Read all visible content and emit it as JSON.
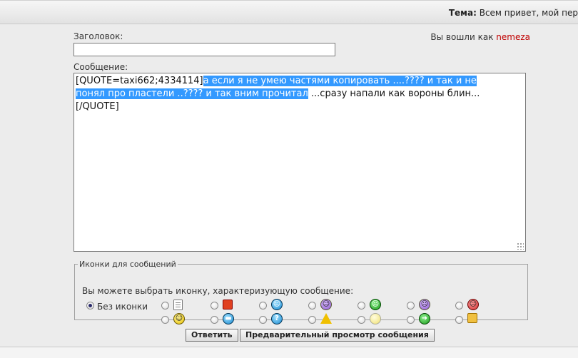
{
  "header": {
    "topic_label": "Тема:",
    "topic_text": "Всем привет, мой пер"
  },
  "form": {
    "title_label": "Заголовок:",
    "title_value": "",
    "logged_in_prefix": "Вы вошли как",
    "username": "nemeza",
    "message_label": "Сообщение:",
    "message": {
      "quote_open": "[QUOTE=taxi662;4334114]",
      "selected_line1": "а  если  я  не умею  частями  копировать ....????  и так  и не",
      "selected_line2": "понял про  пластели ..????   и  так  вним прочитал",
      "rest_line2": " ...сразу  напали  как  вороны  блин...",
      "quote_close": "[/QUOTE]"
    }
  },
  "icons_panel": {
    "legend": "Иконки для сообщений",
    "hint": "Вы можете выбрать иконку, характеризующую сообщение:",
    "no_icon_label": "Без иконки",
    "icon_names": [
      "document-icon",
      "thumbs-down-icon",
      "smile-icon",
      "tongue-icon",
      "grin-icon",
      "sad-icon",
      "angry-icon",
      "smile-icon",
      "cool-icon",
      "question-icon",
      "warning-icon",
      "lightbulb-icon",
      "arrow-right-icon",
      "thumbs-up-icon"
    ]
  },
  "buttons": {
    "submit": "Ответить",
    "preview": "Предварительный просмотр сообщения"
  }
}
